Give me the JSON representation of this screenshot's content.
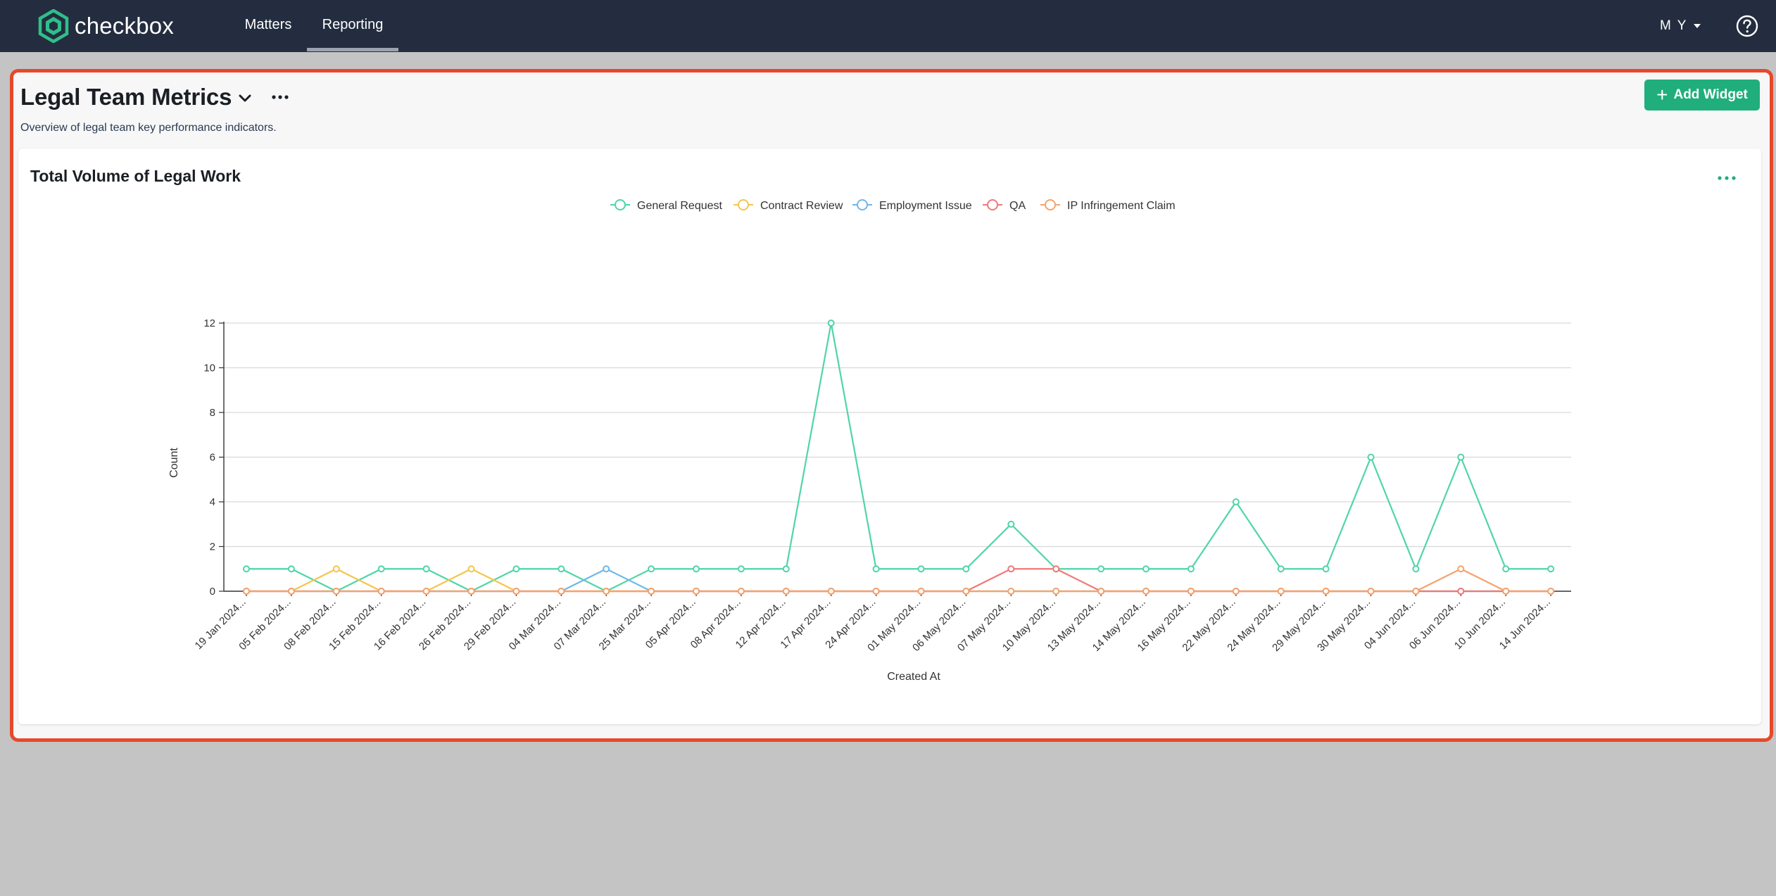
{
  "app": {
    "logo_text": "checkbox",
    "brand_color": "#1fae7c",
    "nav": [
      {
        "label": "Matters",
        "active": false
      },
      {
        "label": "Reporting",
        "active": true
      }
    ],
    "user_initials": "M Y",
    "help_icon": "question-circle-icon"
  },
  "dashboard": {
    "title": "Legal Team Metrics",
    "description": "Overview of legal team key performance indicators.",
    "add_widget_label": "Add Widget",
    "highlight_color": "#e8482a"
  },
  "widget": {
    "title": "Total Volume of Legal Work",
    "more_icon": "more-horizontal-icon"
  },
  "chart_data": {
    "type": "line",
    "title": "Total Volume of Legal Work",
    "xlabel": "Created At",
    "ylabel": "Count",
    "ylim": [
      0,
      12
    ],
    "yticks": [
      0,
      2,
      4,
      6,
      8,
      10,
      12
    ],
    "grid": true,
    "legend_position": "top-center",
    "categories": [
      "19 Jan 2024...",
      "05 Feb 2024...",
      "08 Feb 2024...",
      "15 Feb 2024...",
      "16 Feb 2024...",
      "26 Feb 2024...",
      "29 Feb 2024...",
      "04 Mar 2024...",
      "07 Mar 2024...",
      "25 Mar 2024...",
      "05 Apr 2024...",
      "08 Apr 2024...",
      "12 Apr 2024...",
      "17 Apr 2024...",
      "24 Apr 2024...",
      "01 May 2024...",
      "06 May 2024...",
      "07 May 2024...",
      "10 May 2024...",
      "13 May 2024...",
      "14 May 2024...",
      "16 May 2024...",
      "22 May 2024...",
      "24 May 2024...",
      "29 May 2024...",
      "30 May 2024...",
      "04 Jun 2024...",
      "06 Jun 2024...",
      "10 Jun 2024...",
      "14 Jun 2024..."
    ],
    "series": [
      {
        "name": "General Request",
        "color": "#4fd6a5",
        "values": [
          1,
          1,
          0,
          1,
          1,
          0,
          1,
          1,
          0,
          1,
          1,
          1,
          1,
          12,
          1,
          1,
          1,
          3,
          1,
          1,
          1,
          1,
          4,
          1,
          1,
          6,
          1,
          6,
          1,
          1
        ]
      },
      {
        "name": "Contract Review",
        "color": "#f5c54e",
        "values": [
          0,
          0,
          1,
          0,
          0,
          1,
          0,
          0,
          0,
          0,
          0,
          0,
          0,
          0,
          0,
          0,
          0,
          0,
          0,
          0,
          0,
          0,
          0,
          0,
          0,
          0,
          0,
          0,
          0,
          0
        ]
      },
      {
        "name": "Employment Issue",
        "color": "#6fb7e8",
        "values": [
          0,
          0,
          0,
          0,
          0,
          0,
          0,
          0,
          1,
          0,
          0,
          0,
          0,
          0,
          0,
          0,
          0,
          0,
          0,
          0,
          0,
          0,
          0,
          0,
          0,
          0,
          0,
          0,
          0,
          0
        ]
      },
      {
        "name": "QA",
        "color": "#f07878",
        "values": [
          0,
          0,
          0,
          0,
          0,
          0,
          0,
          0,
          0,
          0,
          0,
          0,
          0,
          0,
          0,
          0,
          0,
          1,
          1,
          0,
          0,
          0,
          0,
          0,
          0,
          0,
          0,
          0,
          0,
          0
        ]
      },
      {
        "name": "IP Infringement Claim",
        "color": "#f5a36b",
        "values": [
          0,
          0,
          0,
          0,
          0,
          0,
          0,
          0,
          0,
          0,
          0,
          0,
          0,
          0,
          0,
          0,
          0,
          0,
          0,
          0,
          0,
          0,
          0,
          0,
          0,
          0,
          0,
          1,
          0,
          0
        ]
      }
    ]
  }
}
